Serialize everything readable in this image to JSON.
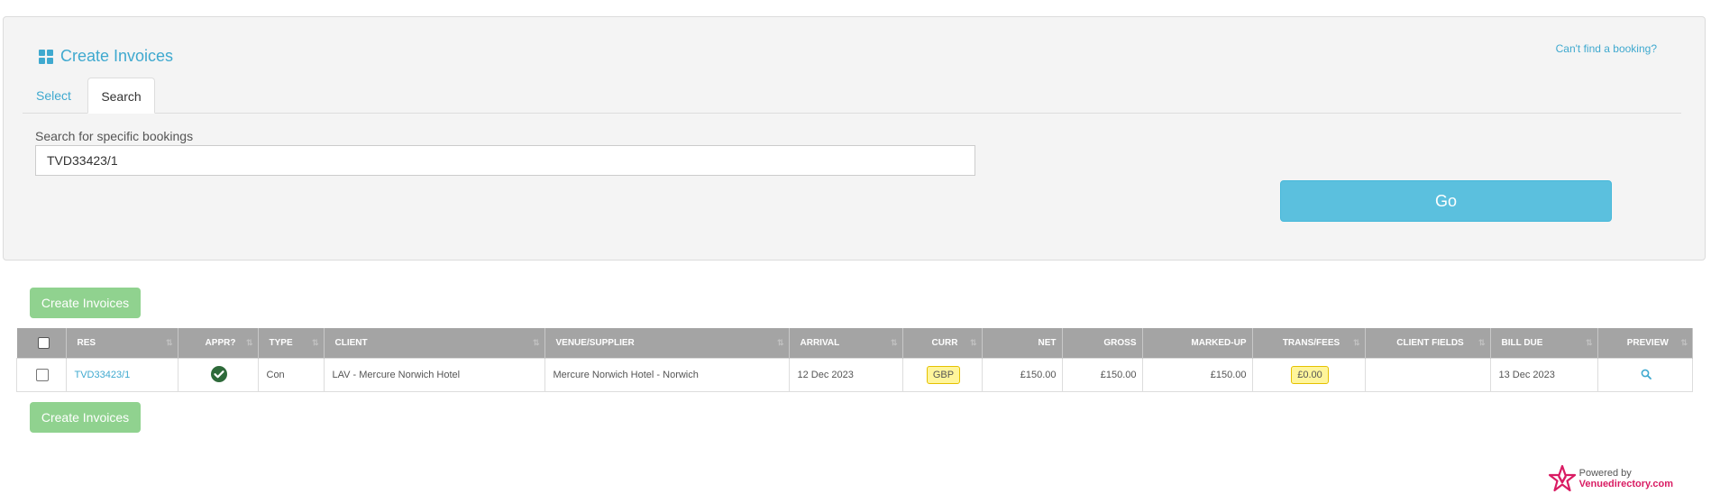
{
  "panel": {
    "title": "Create Invoices",
    "cant_find": "Can't find a booking?",
    "tabs": [
      {
        "label": "Select"
      },
      {
        "label": "Search"
      }
    ],
    "search_label": "Search for specific bookings",
    "search_value": "TVD33423/1",
    "go_label": "Go"
  },
  "actions": {
    "create_invoices_label": "Create Invoices"
  },
  "table": {
    "headers": {
      "res": "RES",
      "appr": "APPR?",
      "type": "TYPE",
      "client": "CLIENT",
      "venue": "VENUE/SUPPLIER",
      "arrival": "ARRIVAL",
      "curr": "CURR",
      "net": "NET",
      "gross": "GROSS",
      "marked_up": "MARKED-UP",
      "trans_fees": "TRANS/FEES",
      "client_fields": "CLIENT FIELDS",
      "bill_due": "BILL DUE",
      "preview": "PREVIEW"
    },
    "rows": [
      {
        "res": "TVD33423/1",
        "approved": true,
        "type": "Con",
        "client": "LAV - Mercure Norwich Hotel",
        "venue": "Mercure Norwich Hotel - Norwich",
        "arrival": "12 Dec 2023",
        "curr": "GBP",
        "net": "£150.00",
        "gross": "£150.00",
        "marked_up": "£150.00",
        "trans_fees": "£0.00",
        "client_fields": "",
        "bill_due": "13 Dec 2023"
      }
    ]
  },
  "footer": {
    "powered_by": "Powered by",
    "brand": "Venuedirectory.com"
  },
  "colors": {
    "accent": "#3fa9cf",
    "go_button": "#5bc0de",
    "create_button": "#90d28f",
    "header_bg": "#a4a4a4",
    "badge_bg": "#fff59b",
    "approved": "#2e6a3a",
    "brand": "#d91c63"
  },
  "icons": {
    "title": "grid-icon",
    "approved": "check-circle-icon",
    "preview": "search-icon",
    "sort": "sort-icon",
    "logo": "star-v-logo-icon"
  }
}
